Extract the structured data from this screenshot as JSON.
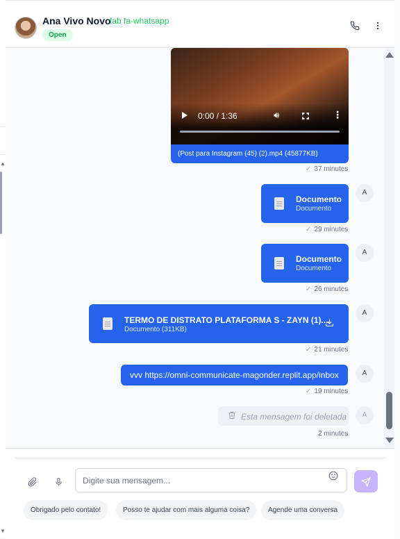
{
  "header": {
    "contact_name": "Ana Vivo Novo",
    "channel_text": "fab fa-whatsapp",
    "status": "Open",
    "phone_icon": "phone-icon",
    "more_icon": "more-vertical-icon"
  },
  "messages": {
    "video": {
      "time_display": "0:00 / 1:36",
      "caption": "(Post para Instagram (45) (2).mp4 (45877KB)",
      "timestamp": "37 minutes"
    },
    "doc1": {
      "title": "Documento",
      "subtitle": "Documento",
      "timestamp": "29 minutes",
      "avatar": "A"
    },
    "doc2": {
      "title": "Documento",
      "subtitle": "Documento",
      "timestamp": "26 minutes",
      "avatar": "A"
    },
    "doc3": {
      "title": "TERMO DE DISTRATO PLATAFORMA S - ZAYN (1)....",
      "subtitle": "Documento (311KB)",
      "timestamp": "21 minutes",
      "avatar": "A"
    },
    "text1": {
      "text": "vvv https://omni-communicate-magonder.replit.app/inbox",
      "timestamp": "19 minutes",
      "avatar": "A"
    },
    "deleted": {
      "text": "Esta mensagem foi deletada",
      "timestamp": "2 minutes",
      "avatar": "A"
    }
  },
  "composer": {
    "placeholder": "Digite sua mensagem...",
    "quick_replies": [
      "Obrigado pelo contato!",
      "Posso te ajudar com mais alguma coisa?",
      "Agende uma conversa"
    ]
  },
  "colors": {
    "accent": "#2563eb",
    "status_green": "#16a34a",
    "send_button": "#c4b5fd"
  }
}
